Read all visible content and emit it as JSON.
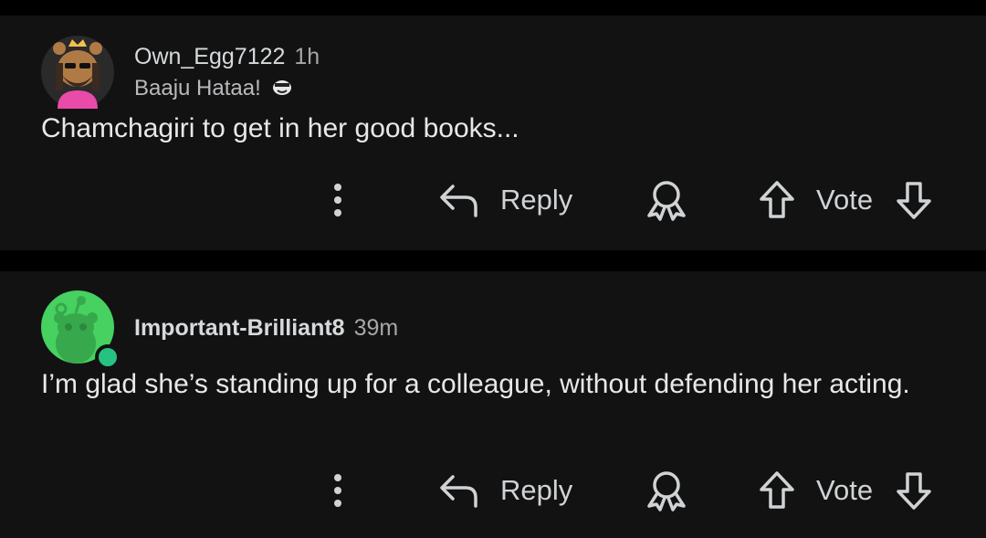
{
  "comments": [
    {
      "username": "Own_Egg7122",
      "time": "1h",
      "flair": "Baaju Hataa!",
      "body": "Chamchagiri to get in her good books...",
      "reply_label": "Reply",
      "vote_label": "Vote"
    },
    {
      "username": "Important-Brilliant8",
      "time": "39m",
      "body": "I’m glad she’s standing up for a colleague, without defending her acting.",
      "reply_label": "Reply",
      "vote_label": "Vote",
      "online": true
    }
  ],
  "icons": [
    "more-icon",
    "reply-arrow-icon",
    "award-icon",
    "upvote-icon",
    "downvote-icon",
    "flair-emoji-icon"
  ],
  "colors": {
    "background": "#000000",
    "card": "#121212",
    "text": "#d7dadc",
    "online_dot": "#26c281",
    "default_avatar": "#46d160"
  }
}
